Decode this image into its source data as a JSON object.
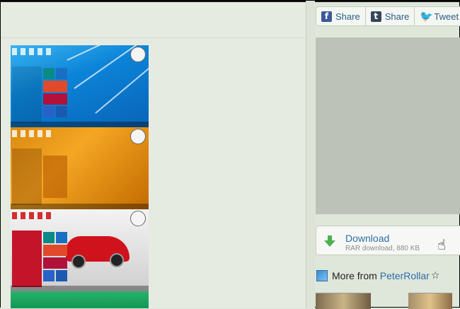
{
  "share_bar": {
    "buttons": [
      {
        "label": "Share",
        "icon": "facebook-icon",
        "glyph": "f"
      },
      {
        "label": "Share",
        "icon": "tumblr-icon",
        "glyph": "t"
      },
      {
        "label": "Tweet",
        "icon": "twitter-icon",
        "glyph": "🐦"
      }
    ]
  },
  "download": {
    "label": "Download",
    "subtitle": "RAR download, 880 KB"
  },
  "more_from": {
    "prefix": "More from",
    "author": "PeterRollar",
    "star": "☆"
  },
  "preview": {
    "screenshots": [
      "windows-8-blue-start-screen",
      "windows-8-orange-start-screen",
      "windows-8-red-car-start-screen",
      "windows-8-green-start-screen"
    ]
  },
  "colors": {
    "link": "#2a6ea8",
    "background": "#dfe6da",
    "ad_placeholder": "#bcc2b7",
    "download_arrow": "#4caf50"
  }
}
